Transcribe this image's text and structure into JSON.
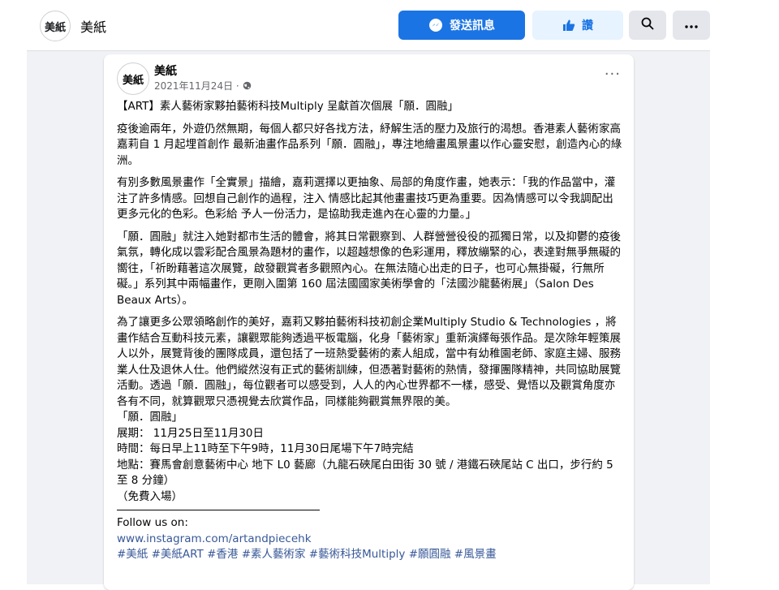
{
  "header": {
    "avatar_text": "美紙",
    "page_name": "美紙",
    "message_button": "發送訊息",
    "like_button": "讚"
  },
  "post": {
    "avatar_text": "美紙",
    "author": "美紙",
    "date": "2021年11月24日 ·",
    "title": "【ART】素人藝術家夥拍藝術科技Multiply 呈獻首次個展「願．圓融」",
    "para1": "疫後逾兩年，外遊仍然無期，每個人都只好各找方法，紓解生活的壓力及旅行的渴想。香港素人藝術家高嘉莉自 1 月起埋首創作 最新油畫作品系列「願．圓融」，專注地繪畫風景畫以作心靈安慰，創造內心的綠洲。",
    "para2": "有別多數風景畫作「全實景」描繪，嘉莉選擇以更抽象、局部的角度作畫，她表示：「我的作品當中，灌注了許多情感。回想自己創作的過程，注入 情感比起其他畫畫技巧更為重要。因為情感可以令我調配出更多元化的色彩。色彩給 予人一份活力，是協助我走進內在心靈的力量。」",
    "para3": "「願．圓融」就注入她對都市生活的體會，將其日常觀察到、人群營營役役的孤獨日常，以及抑鬱的疫後氣氛，轉化成以雲彩配合風景為題材的畫作，以超越想像的色彩運用，釋放繃緊的心，表達對無爭無礙的嚮往，「祈盼藉著這次展覽，啟發觀賞者多觀照內心。在無法隨心出走的日子，也可心無掛礙，行無所礙。」系列其中兩幅畫作，更剛入圍第 160 屆法國國家美術學會的「法國沙龍藝術展」（Salon Des Beaux Arts）。",
    "para4": "為了讓更多公眾領略創作的美好，嘉莉又夥拍藝術科技初創企業Multiply Studio & Technologies ，將畫作結合互動科技元素，讓觀眾能夠透過平板電腦，化身「藝術家」重新演繹每張作品。是次除年輕策展人以外，展覽背後的團隊成員，還包括了一班熱愛藝術的素人組成，當中有幼稚園老師、家庭主婦、服務業人仕及退休人仕。他們縱然沒有正式的藝術訓練，但憑著對藝術的熱情，發揮團隊精神，共同協助展覽活動。透過「願．圓融」，每位觀者可以感受到，人人的內心世界都不一樣，感受、覺悟以及觀賞角度亦各有不同，就算觀眾只憑視覺去欣賞作品，同樣能夠觀賞無界限的美。",
    "info": [
      "「願．圓融」",
      "展期： 11月25日至11月30日",
      "時間：每日早上11時至下午9時，11月30日尾場下午7時完結",
      "地點：賽馬會創意藝術中心 地下 L0 藝廊（九龍石硤尾白田街 30 號 / 港鐵石硤尾站 C 出口，步行約 5 至 8 分鐘）",
      "（免費入場）"
    ],
    "follow": "Follow us on:",
    "instagram": "www.instagram.com/artandpiecehk",
    "hashtags": "#美紙 #美紙ART #香港 #素人藝術家 #藝術科技Multiply #願圓融 #風景畫"
  }
}
